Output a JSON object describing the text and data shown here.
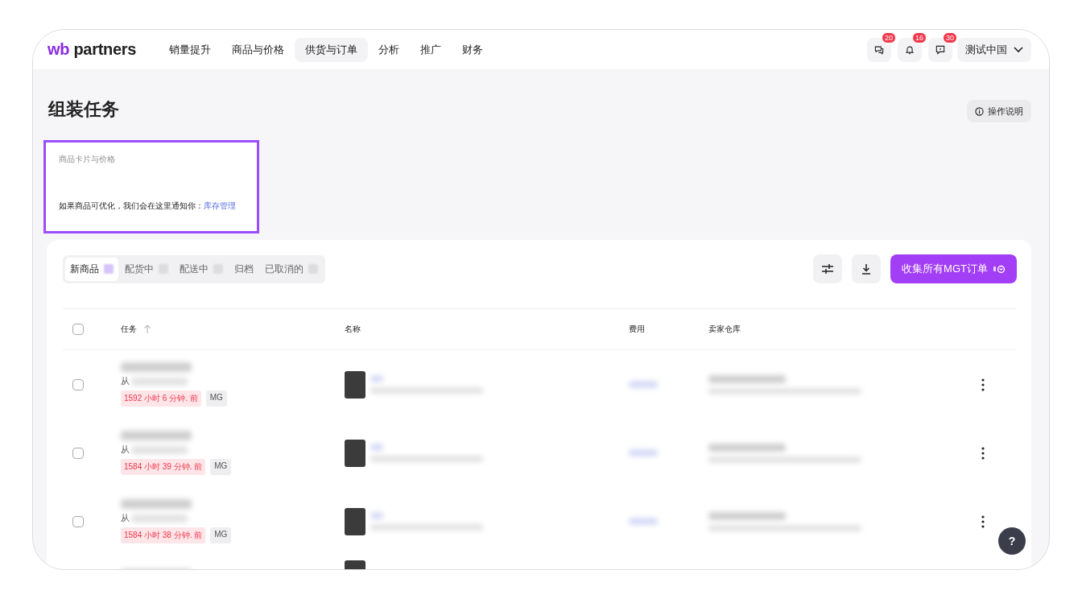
{
  "header": {
    "logo": {
      "mark": "wb",
      "name": "partners"
    },
    "nav": [
      {
        "label": "销量提升",
        "selected": false
      },
      {
        "label": "商品与价格",
        "selected": false
      },
      {
        "label": "供货与订单",
        "selected": true
      },
      {
        "label": "分析",
        "selected": false
      },
      {
        "label": "推广",
        "selected": false
      },
      {
        "label": "财务",
        "selected": false
      }
    ],
    "icons": [
      {
        "kind": "chat",
        "badge": "20"
      },
      {
        "kind": "bell",
        "badge": "16"
      },
      {
        "kind": "feedback",
        "badge": "30"
      }
    ],
    "account": "测试中国"
  },
  "page": {
    "title": "组装任务",
    "help_button": "操作说明"
  },
  "notice": {
    "title": "商品卡片与价格",
    "text": "如果商品可优化，我们会在这里通知你：",
    "link": "库存管理"
  },
  "tabs": [
    {
      "label": "新商品",
      "selected": true,
      "count_hidden": true
    },
    {
      "label": "配货中",
      "selected": false,
      "count_hidden": true
    },
    {
      "label": "配送中",
      "selected": false,
      "count_hidden": true
    },
    {
      "label": "归档",
      "selected": false,
      "count_hidden": false
    },
    {
      "label": "已取消的",
      "selected": false,
      "count_hidden": true
    }
  ],
  "actions": {
    "primary": "收集所有MGT订单"
  },
  "table": {
    "select_all": false,
    "columns": [
      {
        "label": "任务",
        "sortable": true
      },
      {
        "label": "名称",
        "sortable": false
      },
      {
        "label": "费用",
        "sortable": false
      },
      {
        "label": "卖家仓库",
        "sortable": false
      }
    ],
    "rows": [
      {
        "checked": false,
        "from": "从",
        "age": "1592 小时 6 分钟. 前",
        "tag": "MG"
      },
      {
        "checked": false,
        "from": "从",
        "age": "1584 小时 39 分钟. 前",
        "tag": "MG"
      },
      {
        "checked": false,
        "from": "从",
        "age": "1584 小时 38 分钟. 前",
        "tag": "MG"
      }
    ]
  },
  "help": "?"
}
